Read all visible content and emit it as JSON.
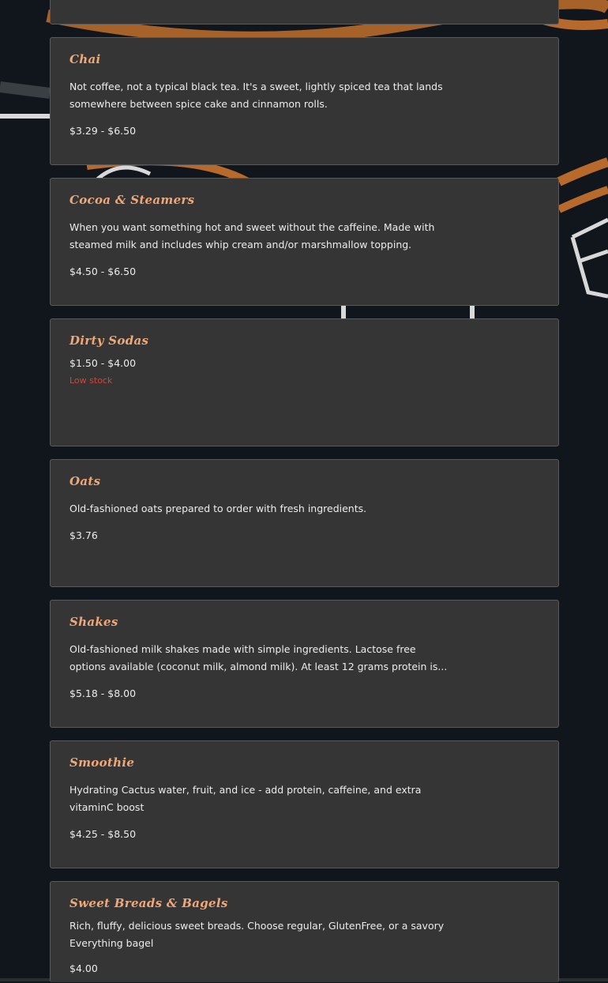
{
  "items": [
    {
      "name": "",
      "description": "",
      "price": ""
    },
    {
      "name": "Chai",
      "description": "Not coffee, not a typical black tea. It's a sweet, lightly spiced tea that lands somewhere between spice cake and cinnamon rolls.",
      "price": "$3.29 - $6.50"
    },
    {
      "name": "Cocoa & Steamers",
      "description": "When you want something hot and sweet without the caffeine. Made with steamed milk and includes whip cream and/or marshmallow topping.",
      "price": "$4.50 - $6.50"
    },
    {
      "name": "Dirty Sodas",
      "price": "$1.50 - $4.00",
      "stock": "Low stock"
    },
    {
      "name": "Oats",
      "description": "Old-fashioned oats prepared to order with fresh ingredients.",
      "price": "$3.76"
    },
    {
      "name": "Shakes",
      "description": "Old-fashioned milk shakes made with simple ingredients. Lactose free options available (coconut milk, almond milk). At least 12 grams protein is...",
      "price": "$5.18 - $8.00"
    },
    {
      "name": "Smoothie",
      "description": "Hydrating Cactus water, fruit, and ice - add protein, caffeine, and extra vitaminC boost",
      "price": "$4.25 - $8.50"
    },
    {
      "name": "Sweet Breads & Bagels",
      "description": "Rich, fluffy, delicious sweet breads. Choose regular, GlutenFree, or a savory Everything bagel",
      "price": "$4.00"
    }
  ],
  "colors": {
    "background": "#10161c",
    "card": "#353535",
    "card_border": "#5a5a5a",
    "item_name": "#f0a878",
    "text": "#ececec",
    "low_stock": "#d2453a",
    "decor_orange": "#b86a2c",
    "decor_white": "#d8d8d8"
  }
}
